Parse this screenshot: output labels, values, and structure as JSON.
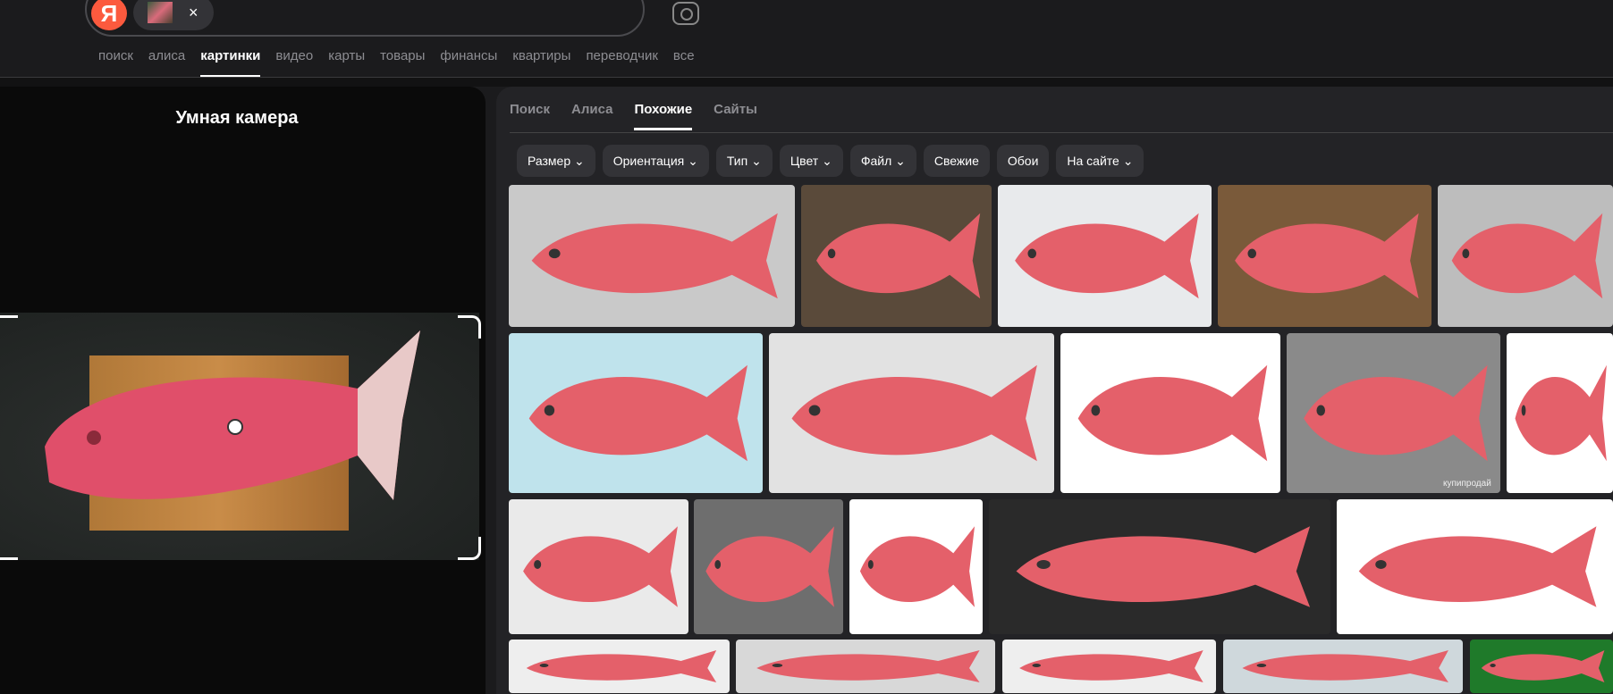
{
  "header": {
    "logo": "Я",
    "remove_image": "×",
    "nav": [
      "поиск",
      "алиса",
      "картинки",
      "видео",
      "карты",
      "товары",
      "финансы",
      "квартиры",
      "переводчик",
      "все"
    ],
    "active_nav": "картинки"
  },
  "left_panel": {
    "title": "Умная камера"
  },
  "results": {
    "tabs": [
      "Поиск",
      "Алиса",
      "Похожие",
      "Сайты"
    ],
    "active_tab": "Похожие",
    "filters": [
      {
        "label": "Размер",
        "dropdown": true
      },
      {
        "label": "Ориентация",
        "dropdown": true
      },
      {
        "label": "Тип",
        "dropdown": true
      },
      {
        "label": "Цвет",
        "dropdown": true
      },
      {
        "label": "Файл",
        "dropdown": true
      },
      {
        "label": "Свежие",
        "dropdown": false
      },
      {
        "label": "Обои",
        "dropdown": false
      },
      {
        "label": "На сайте",
        "dropdown": true
      }
    ],
    "watermark": "купипродай"
  },
  "colors": {
    "logo": "#fc5a3e",
    "background": "#1b1b1d",
    "panel": "#232326"
  }
}
